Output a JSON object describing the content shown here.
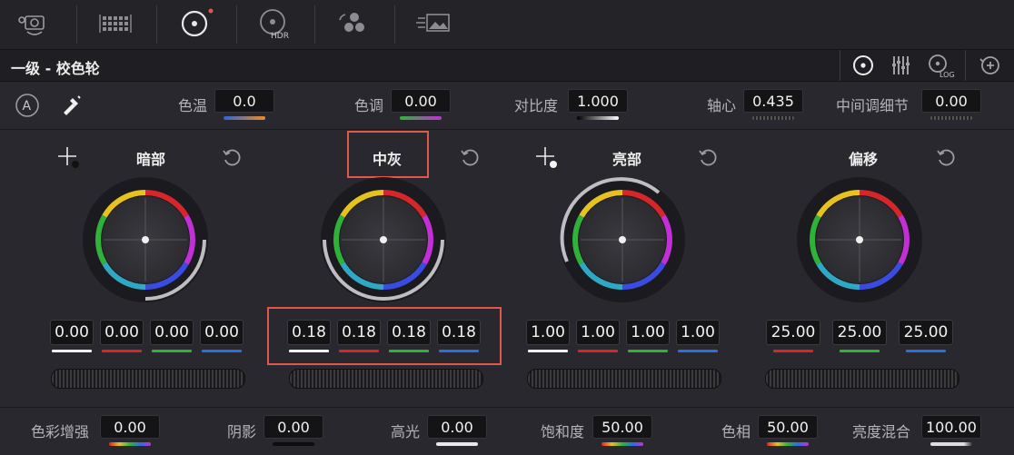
{
  "toolbar": {
    "icons": [
      "camera-raw-icon",
      "color-match-icon",
      "color-wheels-icon",
      "hdr-icon",
      "rgb-mixer-icon",
      "motion-effects-icon"
    ],
    "hdr_label": "HDR"
  },
  "panel": {
    "title": "一级 - 校色轮",
    "modes": [
      "wheels-mode-icon",
      "bars-mode-icon",
      "log-mode-icon"
    ],
    "log_label": "LOG"
  },
  "adjust": {
    "auto_label": "A",
    "temp_label": "色温",
    "temp_value": "0.0",
    "tint_label": "色调",
    "tint_value": "0.00",
    "contrast_label": "对比度",
    "contrast_value": "1.000",
    "pivot_label": "轴心",
    "pivot_value": "0.435",
    "detail_label": "中间调细节",
    "detail_value": "0.00"
  },
  "wheels": [
    {
      "title": "暗部",
      "values": [
        "0.00",
        "0.00",
        "0.00",
        "0.00"
      ]
    },
    {
      "title": "中灰",
      "values": [
        "0.18",
        "0.18",
        "0.18",
        "0.18"
      ]
    },
    {
      "title": "亮部",
      "values": [
        "1.00",
        "1.00",
        "1.00",
        "1.00"
      ]
    },
    {
      "title": "偏移",
      "values": [
        "25.00",
        "25.00",
        "25.00"
      ]
    }
  ],
  "bottom": {
    "boost_label": "色彩增强",
    "boost_value": "0.00",
    "shadows_label": "阴影",
    "shadows_value": "0.00",
    "highlights_label": "高光",
    "highlights_value": "0.00",
    "sat_label": "饱和度",
    "sat_value": "50.00",
    "hue_label": "色相",
    "hue_value": "50.00",
    "lummix_label": "亮度混合",
    "lummix_value": "100.00"
  },
  "colors": {
    "highlight": "#e0574b",
    "red": "#d6262a",
    "green": "#2fb23a",
    "blue": "#2a6fe0",
    "white": "#f0f0f0"
  }
}
